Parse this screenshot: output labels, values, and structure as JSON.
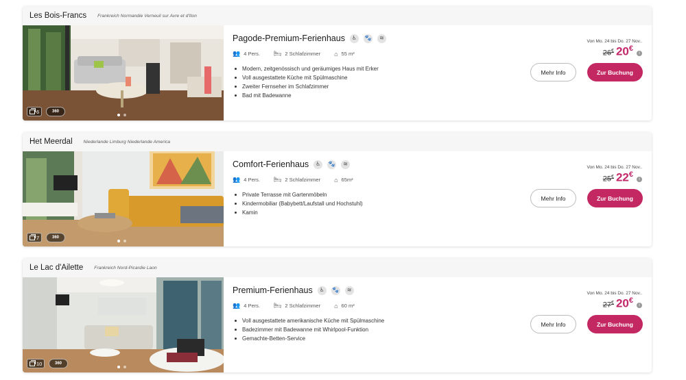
{
  "listings": [
    {
      "park_name": "Les Bois-Francs",
      "region": "Frankreich  Normandie  Verneuil sur Avre et d'Iton",
      "house_title": "Pagode-Premium-Ferienhaus",
      "persons": "4 Pers.",
      "bedrooms": "2 Schlafzimmer",
      "area": "55 m²",
      "features": [
        "Modern, zeitgenössisch und geräumiges Haus mit Erker",
        "Voll ausgestattete Küche mit Spülmaschine",
        "Zweiter Fernseher im Schlafzimmer",
        "Bad mit Badewanne"
      ],
      "dates": "Von Mo. 24 bis Do. 27 Nov..",
      "old_price": "26",
      "new_price": "20",
      "currency": "€",
      "photo_count": "6",
      "badge_360": "360",
      "more_info_label": "Mehr Info",
      "book_label": "Zur Buchung"
    },
    {
      "park_name": "Het Meerdal",
      "region": "Niederlande  Limburg  Niederlande  America",
      "house_title": "Comfort-Ferienhaus",
      "persons": "4 Pers.",
      "bedrooms": "2 Schlafzimmer",
      "area": "65m²",
      "features": [
        "Private Terrasse mit Gartenmöbeln",
        "Kindermobiliar (Babybett/Laufstall und Hochstuhl)",
        "Kamin"
      ],
      "dates": "Von Mo. 24 bis Do. 27 Nov..",
      "old_price": "25",
      "new_price": "22",
      "currency": "€",
      "photo_count": "7",
      "badge_360": "360",
      "more_info_label": "Mehr Info",
      "book_label": "Zur Buchung"
    },
    {
      "park_name": "Le Lac d'Ailette",
      "region": "Frankreich  Nord-Picardie  Laon",
      "house_title": "Premium-Ferienhaus",
      "persons": "4 Pers.",
      "bedrooms": "2 Schlafzimmer",
      "area": "60 m²",
      "features": [
        "Voll ausgestattete amerikanische Küche mit Spülmaschine",
        "Badezimmer mit Badewanne mit Whirlpool-Funktion",
        "Gemachte-Betten-Service"
      ],
      "dates": "Von Mo. 24 bis Do. 27 Nov..",
      "old_price": "27",
      "new_price": "20",
      "currency": "€",
      "photo_count": "10",
      "badge_360": "360",
      "more_info_label": "Mehr Info",
      "book_label": "Zur Buchung"
    }
  ],
  "icons": {
    "amenities": [
      "wheelchair-icon",
      "pet-icon",
      "wifi-icon"
    ],
    "specs": [
      "persons-icon",
      "bed-icon",
      "house-icon"
    ]
  },
  "colors": {
    "accent": "#c42863",
    "price": "#c22869"
  }
}
